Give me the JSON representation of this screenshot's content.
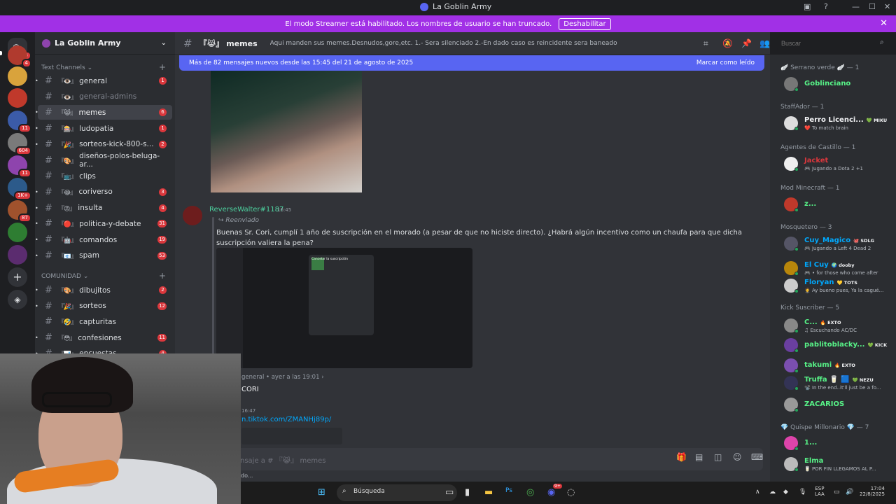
{
  "window": {
    "title": "La Goblin Army"
  },
  "banner": {
    "text": "El modo Streamer está habilitado. Los nombres de usuario se han truncado.",
    "button": "Deshabilitar"
  },
  "rail": {
    "home_badge": "383",
    "badges": [
      "4",
      "11",
      "604",
      "11",
      "1K+",
      "87"
    ]
  },
  "guild": {
    "name": "La Goblin Army"
  },
  "categories": {
    "text": "Text Channels",
    "community": "COMUNIDAD"
  },
  "channels": [
    {
      "emoji": "『👁️』",
      "name": "general",
      "badge": "1"
    },
    {
      "emoji": "『👁️』",
      "name": "general-admins",
      "badge": ""
    },
    {
      "emoji": "『😹』",
      "name": "memes",
      "badge": "6"
    },
    {
      "emoji": "『🎰』",
      "name": "ludopatia",
      "badge": "1"
    },
    {
      "emoji": "『🎉』",
      "name": "sorteos-kick-800-s...",
      "badge": "2"
    },
    {
      "emoji": "『🎨』",
      "name": "diseños-polos-beluga-ar...",
      "badge": ""
    },
    {
      "emoji": "『📺』",
      "name": "clips",
      "badge": ""
    },
    {
      "emoji": "『😂』",
      "name": "coriverso",
      "badge": "3"
    },
    {
      "emoji": "『😡』",
      "name": "insulta",
      "badge": "4"
    },
    {
      "emoji": "『🔴』",
      "name": "politica-y-debate",
      "badge": "31"
    },
    {
      "emoji": "『🤖』",
      "name": "comandos",
      "badge": "19"
    },
    {
      "emoji": "『📧』",
      "name": "spam",
      "badge": "53"
    }
  ],
  "community_channels": [
    {
      "emoji": "『🎨』",
      "name": "dibujitos",
      "badge": "2"
    },
    {
      "emoji": "『🎉』",
      "name": "sorteos",
      "badge": "12"
    },
    {
      "emoji": "『🤣』",
      "name": "capturitas",
      "badge": ""
    },
    {
      "emoji": "『😳』",
      "name": "confesiones",
      "badge": "11"
    },
    {
      "emoji": "『📊』",
      "name": "encuestas",
      "badge": "4"
    }
  ],
  "header": {
    "channel": "『😹』 memes",
    "topic": "Aqui manden sus memes.Desnudos,gore,etc. 1.- Sera silenciado 2.-En dado caso es reincidente sera baneado",
    "search_placeholder": "Buscar"
  },
  "new_messages": {
    "text": "Más de 82 mensajes nuevos desde las 15:45 del 21 de agosto de 2025",
    "action": "Marcar como leído"
  },
  "message": {
    "author": "ReverseWalter#1187",
    "time": "16:45",
    "forwarded": "Reenviado",
    "text": "Buenas Sr. Cori, cumplí 1 año de suscripción en el morado (a pesar de que no hiciste directo). ¿Habrá algún incentivo como un chaufa para que dicha suscripción valiera la pena?",
    "screenshot_title": "Cancelar la suscripción"
  },
  "reply": {
    "context": "general • ayer a las 19:01 ›",
    "text": "CORI",
    "time": "16:47",
    "link": "n.tiktok.com/ZMANHj89p/"
  },
  "composer": {
    "placeholder": "nsaje a # 『😹』 memes",
    "typing": "do..."
  },
  "members": {
    "groups": [
      {
        "title": "🪽 Serrano verde 🪽 — 1",
        "members": [
          {
            "name": "Goblinciano",
            "color": "#57f287",
            "tag": "",
            "sub": ""
          }
        ]
      },
      {
        "title": "StaffAdor — 1",
        "members": [
          {
            "name": "Perro Licenci...",
            "color": "#f2f3f5",
            "tag": "💚 MIKU",
            "sub": "❤️ To match brain"
          }
        ]
      },
      {
        "title": "Agentes de Castillo — 1",
        "members": [
          {
            "name": "Jacket",
            "color": "#da373c",
            "tag": "",
            "sub": "🎮 Jugando a Dota 2 +1"
          }
        ]
      },
      {
        "title": "Mod Minecraft — 1",
        "members": [
          {
            "name": "z...",
            "color": "#57f287",
            "tag": "",
            "sub": ""
          }
        ]
      },
      {
        "title": "Mosquetero — 3",
        "members": [
          {
            "name": "Cuy_Magico",
            "color": "#00a8fc",
            "tag": "🐙 SDLG",
            "sub": "🎮 Jugando a Left 4 Dead 2"
          },
          {
            "name": "El Cuy",
            "color": "#00a8fc",
            "tag": "🌍 dooby",
            "sub": "🎮 • for those who come after"
          },
          {
            "name": "Floryan",
            "color": "#00a8fc",
            "tag": "💛 TOTS",
            "sub": "🤵 Ay bueno pues, Ya la cagué..."
          }
        ]
      },
      {
        "title": "Kick Suscriber — 5",
        "members": [
          {
            "name": "C...",
            "color": "#57f287",
            "tag": "🔥 EXTO",
            "sub": "♫ Escuchando AC/DC"
          },
          {
            "name": "pablitoblacky...",
            "color": "#57f287",
            "tag": "💚 KICK",
            "sub": ""
          },
          {
            "name": "takumi",
            "color": "#57f287",
            "tag": "🔥 EXTO",
            "sub": ""
          },
          {
            "name": "Truffa 🥛 🟦",
            "color": "#57f287",
            "tag": "💚 NEZU",
            "sub": "📽️ In the end..it'll just be a fo..."
          },
          {
            "name": "ZACARIOS",
            "color": "#57f287",
            "tag": "",
            "sub": ""
          }
        ]
      },
      {
        "title": "💎 Quispe Millonario 💎 — 7",
        "members": [
          {
            "name": "1...",
            "color": "#57f287",
            "tag": "",
            "sub": ""
          },
          {
            "name": "Elma",
            "color": "#57f287",
            "tag": "",
            "sub": "🥛 POR FIN LLEGAMOS AL P..."
          }
        ]
      }
    ]
  },
  "taskbar": {
    "search": "Búsqueda",
    "lang": "ESP",
    "lang2": "LAA",
    "time": "17:04",
    "date": "22/8/2025",
    "discord_badge": "9+"
  },
  "colors": {
    "banner": "#a130e6",
    "accent": "#5865f2",
    "badge": "#da373c",
    "online": "#23a55a"
  }
}
